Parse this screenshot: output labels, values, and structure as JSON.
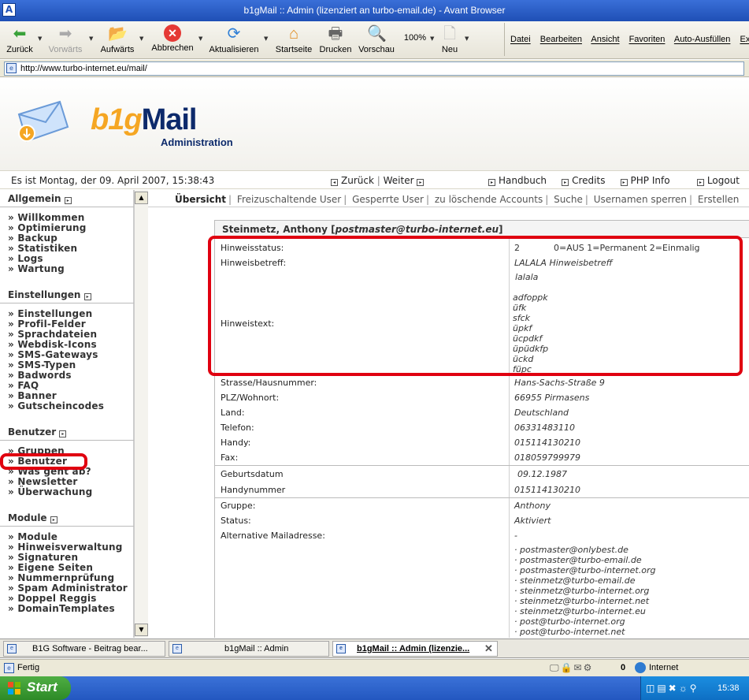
{
  "window": {
    "title": "b1gMail :: Admin (lizenziert an turbo-email.de) - Avant Browser"
  },
  "toolbar": {
    "back": "Zurück",
    "forward": "Vorwärts",
    "up": "Aufwärts",
    "stop": "Abbrechen",
    "refresh": "Aktualisieren",
    "home": "Startseite",
    "print": "Drucken",
    "preview": "Vorschau",
    "zoom": "100%",
    "new": "Neu"
  },
  "menu": [
    "Datei",
    "Bearbeiten",
    "Ansicht",
    "Favoriten",
    "Auto-Ausfüllen",
    "Extra"
  ],
  "address": {
    "url": "http://www.turbo-internet.eu/mail/"
  },
  "brand": {
    "logo_b1g": "b1g",
    "logo_mail": "Mail",
    "logo_sub": "Administration"
  },
  "infobar": {
    "date": "Es ist Montag, der 09. April 2007, 15:38:43",
    "back": "Zurück",
    "forward": "Weiter",
    "handbook": "Handbuch",
    "credits": "Credits",
    "phpinfo": "PHP Info",
    "logout": "Logout"
  },
  "sidebar": {
    "sections": [
      {
        "title": "Allgemein",
        "items": [
          "» Willkommen",
          "» Optimierung",
          "» Backup",
          "» Statistiken",
          "» Logs",
          "» Wartung"
        ]
      },
      {
        "title": "Einstellungen",
        "items": [
          "» Einstellungen",
          "» Profil-Felder",
          "» Sprachdateien",
          "» Webdisk-Icons",
          "» SMS-Gateways",
          "» SMS-Typen",
          "» Badwords",
          "» FAQ",
          "» Banner",
          "» Gutscheincodes"
        ]
      },
      {
        "title": "Benutzer",
        "items": [
          "» Gruppen",
          "» Benutzer",
          "» Was geht ab?",
          "» Newsletter",
          "» Überwachung"
        ]
      },
      {
        "title": "Module",
        "items": [
          "» Module",
          "» Hinweisverwaltung",
          "» Signaturen",
          "» Eigene Seiten",
          "» Nummernprüfung",
          "» Spam Administrator",
          "» Doppel Reggis",
          "» DomainTemplates"
        ]
      }
    ]
  },
  "tabs": [
    "Übersicht",
    "Freizuschaltende User",
    "Gesperrte User",
    "zu löschende Accounts",
    "Suche",
    "Usernamen sperren",
    "Erstellen"
  ],
  "panel": {
    "title_name": "Steinmetz, Anthony",
    "title_email": "postmaster@turbo-internet.eu",
    "hinweisstatus_label": "Hinweisstatus:",
    "hinweisstatus_value": "2",
    "hinweisstatus_hint": "0=AUS 1=Permanent 2=Einmalig",
    "hinweisbetreff_label": "Hinweisbetreff:",
    "hinweisbetreff_value": "LALALA Hinweisbetreff",
    "hinweistext_label": "Hinweistext:",
    "hinweistext_lines": [
      "lalala",
      "",
      "adfoppk",
      "üfk",
      "sfck",
      "üpkf",
      "ücpdkf",
      "üpüdkfp",
      "ückd",
      "füpc"
    ],
    "fields": [
      {
        "label": "Strasse/Hausnummer:",
        "value": "Hans-Sachs-Straße 9"
      },
      {
        "label": "PLZ/Wohnort:",
        "value": "66955 Pirmasens"
      },
      {
        "label": "Land:",
        "value": "Deutschland"
      },
      {
        "label": "Telefon:",
        "value": "06331483110"
      },
      {
        "label": "Handy:",
        "value": "015114130210"
      },
      {
        "label": "Fax:",
        "value": "018059799979"
      },
      {
        "label": "Geburtsdatum",
        "value": "09.12.1987"
      },
      {
        "label": "Handynummer",
        "value": "015114130210"
      },
      {
        "label": "Gruppe:",
        "value": "Anthony"
      },
      {
        "label": "Status:",
        "value": "Aktiviert"
      },
      {
        "label": "Alternative Mailadresse:",
        "value": "-"
      }
    ],
    "aliases": [
      "· postmaster@onlybest.de",
      "· postmaster@turbo-email.de",
      "· postmaster@turbo-internet.org",
      "· steinmetz@turbo-email.de",
      "· steinmetz@turbo-internet.org",
      "· steinmetz@turbo-internet.net",
      "· steinmetz@turbo-internet.eu",
      "· post@turbo-internet.org",
      "· post@turbo-internet.net"
    ]
  },
  "browser_tabs": [
    {
      "label": "B1G Software - Beitrag bear..."
    },
    {
      "label": "b1gMail :: Admin"
    },
    {
      "label": "b1gMail :: Admin (lizenzie..."
    }
  ],
  "status": {
    "text": "Fertig",
    "count": "0",
    "zone": "Internet"
  },
  "taskbar": {
    "start": "Start",
    "clock": "15:38"
  },
  "colors": {
    "highlight_red": "#e00010",
    "logo_orange": "#f5a623",
    "logo_navy": "#0d2a6b"
  }
}
